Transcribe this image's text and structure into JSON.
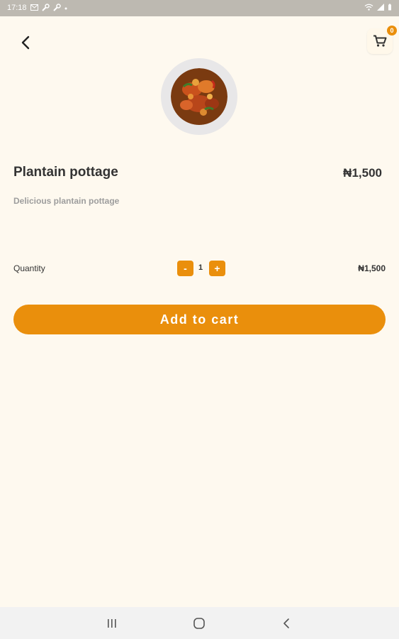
{
  "status_bar": {
    "time": "17:18",
    "icons": [
      "mail-icon",
      "wrench-icon",
      "wrench-icon",
      "dot-icon",
      "wifi-icon",
      "signal-icon",
      "battery-icon"
    ]
  },
  "header": {
    "cart_count": "0"
  },
  "product": {
    "name": "Plantain pottage",
    "price": "₦1,500",
    "description": "Delicious plantain pottage"
  },
  "quantity": {
    "label": "Quantity",
    "minus_label": "-",
    "plus_label": "+",
    "value": "1",
    "line_total": "₦1,500"
  },
  "actions": {
    "add_to_cart_label": "Add to cart"
  },
  "theme": {
    "accent": "#ea8f0c",
    "background": "#fef9ef",
    "text": "#333333",
    "muted_text": "#9d9d9d"
  }
}
